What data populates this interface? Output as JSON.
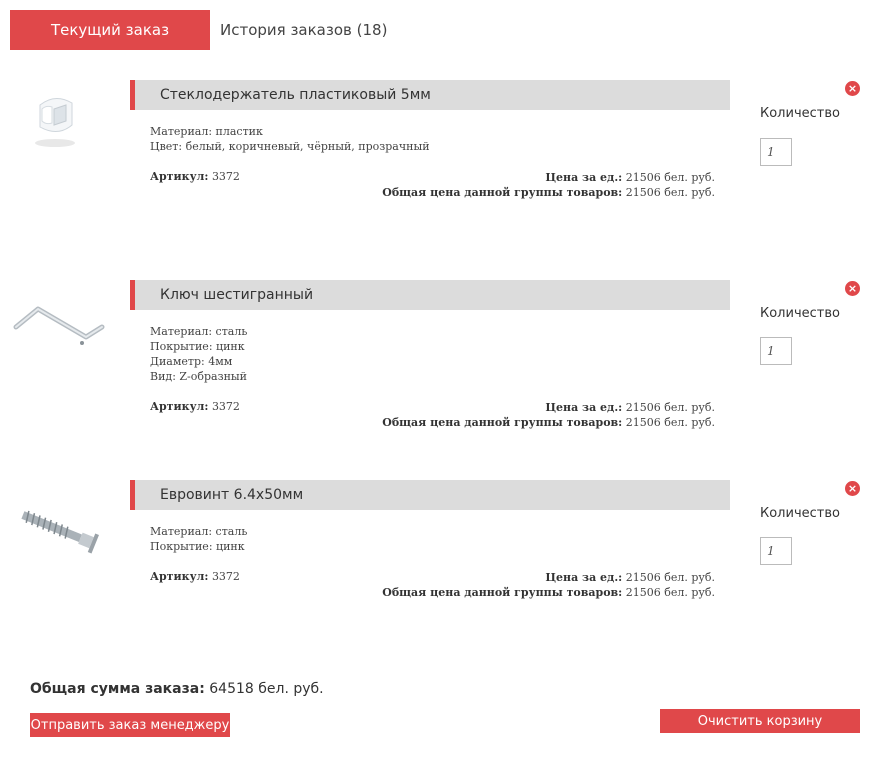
{
  "tabs": {
    "current": "Текущий заказ",
    "history": "История заказов (18)"
  },
  "items": [
    {
      "name": "Стеклодержатель пластиковый 5мм",
      "props": [
        "Материал: пластик",
        "Цвет: белый, коричневый, чёрный, прозрачный"
      ],
      "sku_label": "Артикул:",
      "sku": "3372",
      "unit_price_label": "Цена за ед.:",
      "unit_price": "21506 бел. руб.",
      "group_price_label": "Общая цена данной группы товаров:",
      "group_price": "21506 бел. руб.",
      "qty_label": "Количество",
      "qty": "1",
      "remove": "×"
    },
    {
      "name": "Ключ шестигранный",
      "props": [
        "Материал: сталь",
        "Покрытие: цинк",
        "Диаметр: 4мм",
        "Вид: Z-образный"
      ],
      "sku_label": "Артикул:",
      "sku": "3372",
      "unit_price_label": "Цена за ед.:",
      "unit_price": "21506 бел. руб.",
      "group_price_label": "Общая цена данной группы товаров:",
      "group_price": "21506 бел. руб.",
      "qty_label": "Количество",
      "qty": "1",
      "remove": "×"
    },
    {
      "name": "Евровинт 6.4х50мм",
      "props": [
        "Материал: сталь",
        "Покрытие: цинк"
      ],
      "sku_label": "Артикул:",
      "sku": "3372",
      "unit_price_label": "Цена за ед.:",
      "unit_price": "21506 бел. руб.",
      "group_price_label": "Общая цена данной группы товаров:",
      "group_price": "21506 бел. руб.",
      "qty_label": "Количество",
      "qty": "1",
      "remove": "×"
    }
  ],
  "footer": {
    "total_label": "Общая сумма заказа:",
    "total_value": "64518 бел. руб.",
    "send_button": "Отправить заказ менеджеру",
    "clear_button": "Очистить корзину"
  },
  "colors": {
    "accent": "#e0484a",
    "title_bar": "#dcdcdc"
  }
}
